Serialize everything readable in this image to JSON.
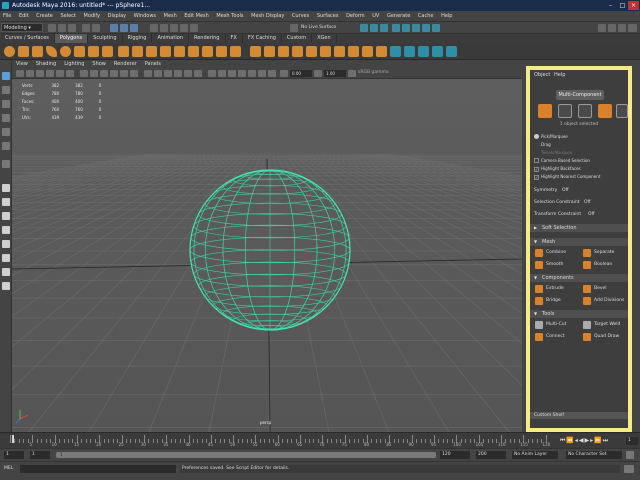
{
  "window": {
    "title": "Autodesk Maya 2016: untitled*   ---   pSphere1..."
  },
  "menubar": [
    "File",
    "Edit",
    "Create",
    "Select",
    "Modify",
    "Display",
    "Windows",
    "Mesh",
    "Edit Mesh",
    "Mesh Tools",
    "Mesh Display",
    "Curves",
    "Surfaces",
    "Deform",
    "UV",
    "Generate",
    "Cache",
    "Help"
  ],
  "statusline": {
    "mode": "Modeling",
    "live_surface": "No Live Surface"
  },
  "shelf": {
    "tabs": [
      "Curves / Surfaces",
      "Polygons",
      "Sculpting",
      "Rigging",
      "Animation",
      "Rendering",
      "FX",
      "FX Caching",
      "Custom",
      "XGen"
    ],
    "active": "Polygons"
  },
  "viewport": {
    "menus": [
      "View",
      "Shading",
      "Lighting",
      "Show",
      "Renderer",
      "Panels"
    ],
    "near_field": "0.00",
    "far_field": "1.00",
    "color_space": "sRGB gamma",
    "hud_rows": [
      {
        "label": "Verts:",
        "a": "382",
        "b": "382",
        "c": "0"
      },
      {
        "label": "Edges:",
        "a": "780",
        "b": "780",
        "c": "0"
      },
      {
        "label": "Faces:",
        "a": "400",
        "b": "400",
        "c": "0"
      },
      {
        "label": "Tris:",
        "a": "760",
        "b": "760",
        "c": "0"
      },
      {
        "label": "UVs:",
        "a": "439",
        "b": "439",
        "c": "0"
      }
    ],
    "camera": "persp"
  },
  "panel": {
    "menus": [
      "Object",
      "Help"
    ],
    "multi_component": "Multi-Component",
    "selected": "1 object selected",
    "pick_options": [
      {
        "label": "Pick/Marquee",
        "state": "dot"
      },
      {
        "label": "Drag",
        "state": "none"
      },
      {
        "label": "Tweak/Marquee",
        "state": "dim"
      },
      {
        "label": "Camera Based Selection",
        "state": "off"
      },
      {
        "label": "Highlight Backfaces",
        "state": "on"
      },
      {
        "label": "Highlight Nearest Component",
        "state": "on"
      }
    ],
    "symmetry_label": "Symmetry",
    "symmetry_value": "Off",
    "sel_constraint_label": "Selection Constraint",
    "sel_constraint_value": "Off",
    "transform_constraint_label": "Transform Constraint",
    "transform_constraint_value": "Off",
    "soft_selection": "Soft Selection",
    "sections": {
      "mesh": {
        "title": "Mesh",
        "tools": [
          "Combine",
          "Separate",
          "Smooth",
          "Boolean"
        ]
      },
      "components": {
        "title": "Components",
        "tools": [
          "Extrude",
          "Bevel",
          "Bridge",
          "Add Divisions"
        ]
      },
      "tools": {
        "title": "Tools",
        "tools": [
          "Multi-Cut",
          "Target Weld",
          "Connect",
          "Quad Draw"
        ]
      }
    },
    "footer": "Custom Shelf",
    "accent": "#f4ec86"
  },
  "timeline": {
    "ticks": [
      "5",
      "10",
      "15",
      "20",
      "25",
      "30",
      "35",
      "40",
      "45",
      "50",
      "55",
      "60",
      "65",
      "70",
      "75",
      "80",
      "85",
      "90",
      "95",
      "100",
      "105",
      "110",
      "115",
      "120"
    ],
    "current": "1"
  },
  "range": {
    "start": "1",
    "start2": "1",
    "mid": "1",
    "end": "120",
    "end2": "120",
    "max": "200",
    "anim_layer": "No Anim Layer",
    "char_set": "No Character Set"
  },
  "cmdline": {
    "lang": "MEL",
    "message": "Preferences saved. See Script Editor for details."
  }
}
